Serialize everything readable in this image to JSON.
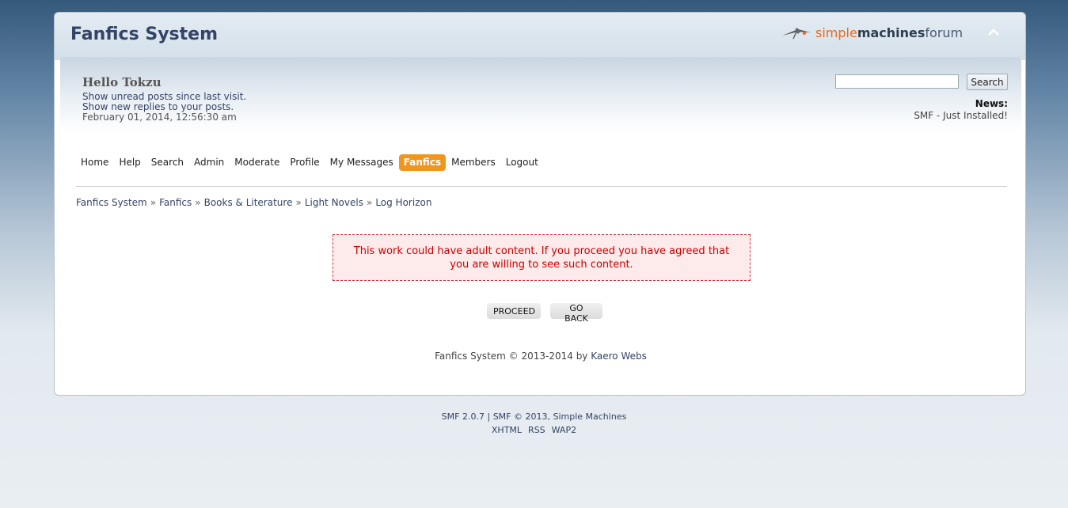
{
  "header": {
    "forum_title": "Fanfics System",
    "logo": {
      "part1": "simple",
      "part2": "machines",
      "part3": " forum",
      "icon": "smf-logo-icon"
    },
    "collapse_icon": "chevron-up-icon"
  },
  "user": {
    "greeting": "Hello Tokzu",
    "unread_link": "Show unread posts since last visit.",
    "replies_link": "Show new replies to your posts.",
    "datetime": "February 01, 2014, 12:56:30 am"
  },
  "search": {
    "value": "",
    "button_label": "Search"
  },
  "news": {
    "label": "News:",
    "text": "SMF - Just Installed!"
  },
  "menu": {
    "items": [
      {
        "label": "Home",
        "active": false
      },
      {
        "label": "Help",
        "active": false
      },
      {
        "label": "Search",
        "active": false
      },
      {
        "label": "Admin",
        "active": false
      },
      {
        "label": "Moderate",
        "active": false
      },
      {
        "label": "Profile",
        "active": false
      },
      {
        "label": "My Messages",
        "active": false
      },
      {
        "label": "Fanfics",
        "active": true
      },
      {
        "label": "Members",
        "active": false
      },
      {
        "label": "Logout",
        "active": false
      }
    ],
    "active_color": "#f0961e"
  },
  "breadcrumb": {
    "separator": "»",
    "items": [
      "Fanfics System",
      "Fanfics",
      "Books & Literature",
      "Light Novels",
      "Log Horizon"
    ]
  },
  "warning": {
    "message": "This work could have adult content. If you proceed you have agreed that you are willing to see such content.",
    "color": "#cc0000"
  },
  "actions": {
    "proceed_label": "PROCEED",
    "back_label": "GO BACK"
  },
  "credit": {
    "prefix": "Fanfics System © 2013-2014 by ",
    "author": "Kaero Webs"
  },
  "footer": {
    "smf_version": "SMF 2.0.7",
    "divider": "|",
    "smf_copyright": "SMF © 2013, Simple Machines",
    "links": [
      "XHTML",
      "RSS",
      "WAP2"
    ]
  }
}
